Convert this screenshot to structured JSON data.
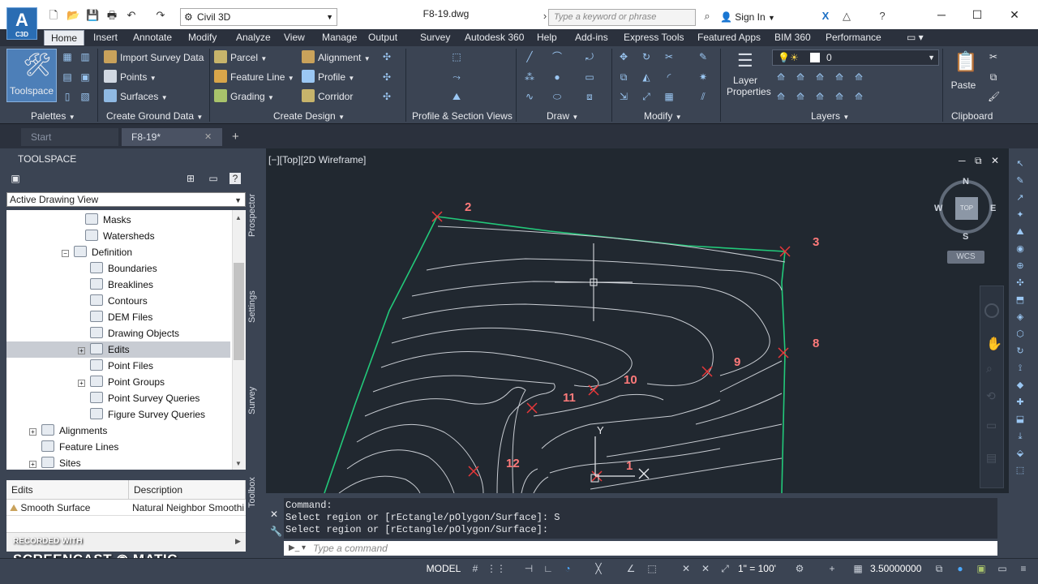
{
  "app": {
    "logo_text": "A",
    "logo_sub": "C3D",
    "workspace": "Civil 3D",
    "document_title": "F8-19.dwg",
    "search_placeholder": "Type a keyword or phrase",
    "sign_in": "Sign In"
  },
  "ribbon_tabs": [
    "Home",
    "Insert",
    "Annotate",
    "Modify",
    "Analyze",
    "View",
    "Manage",
    "Output",
    "Survey",
    "Autodesk 360",
    "Help",
    "Add-ins",
    "Express Tools",
    "Featured Apps",
    "BIM 360",
    "Performance"
  ],
  "ribbon": {
    "toolspace": "Toolspace",
    "import_survey_data": "Import Survey Data",
    "points": "Points",
    "surfaces": "Surfaces",
    "parcel": "Parcel",
    "feature_line": "Feature Line",
    "grading": "Grading",
    "alignment": "Alignment",
    "profile": "Profile",
    "corridor": "Corridor",
    "layer_properties": "Layer Properties",
    "layer_value": "0",
    "paste": "Paste",
    "panels": {
      "palettes": "Palettes",
      "create_ground_data": "Create Ground Data",
      "create_design": "Create Design",
      "profile_section_views": "Profile & Section Views",
      "draw": "Draw",
      "modify": "Modify",
      "layers": "Layers",
      "clipboard": "Clipboard"
    }
  },
  "doc_tabs": {
    "start": "Start",
    "current": "F8-19*"
  },
  "toolspace": {
    "title": "TOOLSPACE",
    "view": "Active Drawing View",
    "tree": [
      {
        "label": "Masks",
        "level": 3,
        "exp": ""
      },
      {
        "label": "Watersheds",
        "level": 3,
        "exp": ""
      },
      {
        "label": "Definition",
        "level": 2,
        "exp": "−"
      },
      {
        "label": "Boundaries",
        "level": 4,
        "exp": ""
      },
      {
        "label": "Breaklines",
        "level": 4,
        "exp": ""
      },
      {
        "label": "Contours",
        "level": 4,
        "exp": ""
      },
      {
        "label": "DEM Files",
        "level": 4,
        "exp": ""
      },
      {
        "label": "Drawing Objects",
        "level": 4,
        "exp": ""
      },
      {
        "label": "Edits",
        "level": 4,
        "exp": "+",
        "selected": true
      },
      {
        "label": "Point Files",
        "level": 4,
        "exp": ""
      },
      {
        "label": "Point Groups",
        "level": 4,
        "exp": "+"
      },
      {
        "label": "Point Survey Queries",
        "level": 4,
        "exp": ""
      },
      {
        "label": "Figure Survey Queries",
        "level": 4,
        "exp": ""
      },
      {
        "label": "Alignments",
        "level": 1,
        "exp": "+"
      },
      {
        "label": "Feature Lines",
        "level": 1,
        "exp": ""
      },
      {
        "label": "Sites",
        "level": 1,
        "exp": "+"
      }
    ],
    "vtabs": [
      "Prospector",
      "Settings",
      "Survey",
      "Toolbox"
    ],
    "edits_headers": [
      "Edits",
      "Description"
    ],
    "edits_rows": [
      [
        "Smooth Surface",
        "Natural Neighbor Smoothi"
      ]
    ]
  },
  "viewport": {
    "label": "[−][Top][2D Wireframe]",
    "compass": {
      "n": "N",
      "s": "S",
      "e": "E",
      "w": "W",
      "top": "TOP"
    },
    "wcs": "WCS",
    "point_labels": [
      "2",
      "3",
      "8",
      "9",
      "10",
      "11",
      "12",
      "1"
    ],
    "ucs_y": "Y"
  },
  "command": {
    "history": [
      "Command:",
      "Select region or [rEctangle/pOlygon/Surface]: S",
      "Select region or [rEctangle/pOlygon/Surface]:"
    ],
    "placeholder": "Type a command"
  },
  "status": {
    "model": "MODEL",
    "scale": "1\" = 100'",
    "coord": "3.50000000"
  },
  "watermark": {
    "top": "RECORDED WITH",
    "main": "SCREENCAST ◉ MATIC"
  },
  "colors": {
    "contour": "#c8ccd2",
    "boundary": "#22c97a",
    "marker": "#e8383a",
    "label": "#ff7a7a"
  }
}
